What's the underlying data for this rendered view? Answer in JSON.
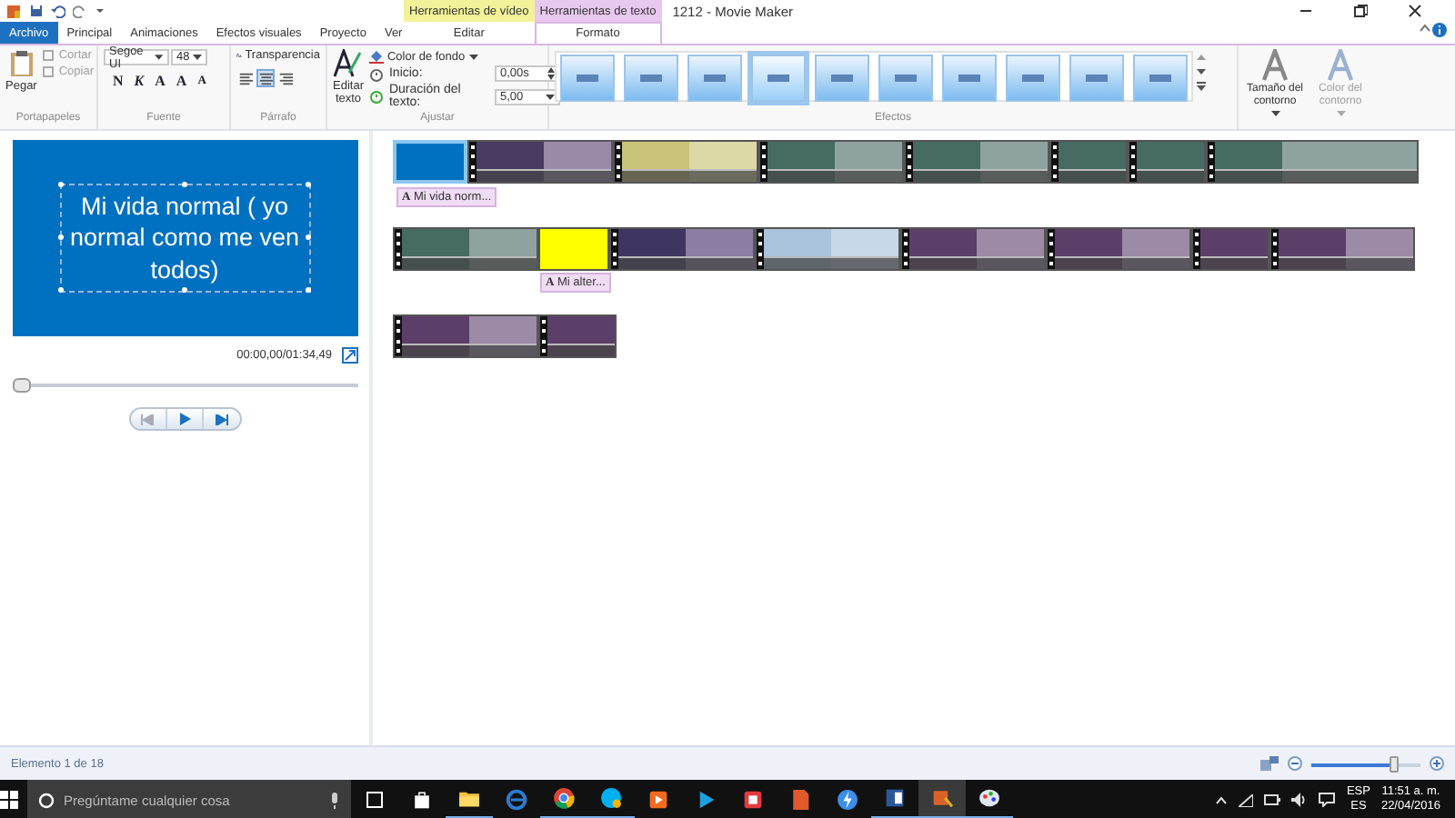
{
  "titlebar": {
    "title": "1212 - Movie Maker",
    "context_groups": [
      {
        "label": "Herramientas de vídeo",
        "color": "#f2f29a",
        "tabs": [
          {
            "label": "Editar",
            "selected": false
          }
        ]
      },
      {
        "label": "Herramientas de texto",
        "color": "#e8c8ef",
        "tabs": [
          {
            "label": "Formato",
            "selected": true
          }
        ]
      }
    ]
  },
  "tabs": [
    {
      "label": "Archivo",
      "kind": "file",
      "selected": false
    },
    {
      "label": "Principal",
      "kind": "tab",
      "selected": false
    },
    {
      "label": "Animaciones",
      "kind": "tab",
      "selected": false
    },
    {
      "label": "Efectos visuales",
      "kind": "tab",
      "selected": false
    },
    {
      "label": "Proyecto",
      "kind": "tab",
      "selected": false
    },
    {
      "label": "Ver",
      "kind": "tab",
      "selected": false
    }
  ],
  "ribbon": {
    "clipboard": {
      "label": "Portapapeles",
      "paste": "Pegar",
      "cut": {
        "label": "Cortar",
        "disabled": true
      },
      "copy": {
        "label": "Copiar",
        "disabled": true
      }
    },
    "font": {
      "label": "Fuente",
      "family": "Segoe UI",
      "size": "48",
      "bold": "N",
      "italic": "K",
      "letter": "A",
      "grow": "A",
      "shrink": "A"
    },
    "paragraph": {
      "label": "Párrafo",
      "transparency": "Transparencia",
      "align": [
        {
          "selected": false
        },
        {
          "selected": true
        },
        {
          "selected": false
        }
      ]
    },
    "adjust": {
      "label": "Ajustar",
      "edit": "Editar texto",
      "background": "Color de fondo",
      "start_label": "Inicio:",
      "start": "0,00s",
      "duration_label": "Duración del texto:",
      "duration": "5,00"
    },
    "effects": {
      "label": "Efectos",
      "items": [
        {
          "selected": false
        },
        {
          "selected": false
        },
        {
          "selected": false
        },
        {
          "selected": true
        },
        {
          "selected": false
        },
        {
          "selected": false
        },
        {
          "selected": false
        },
        {
          "selected": false
        },
        {
          "selected": false
        },
        {
          "selected": false
        }
      ]
    },
    "outline": [
      {
        "label": "Tamaño del contorno",
        "disabled": false
      },
      {
        "label": "Color del contorno",
        "disabled": true
      }
    ]
  },
  "preview": {
    "text": "Mi vida normal ( yo normal como me ven todos)",
    "time": "00:00,00/01:34,49",
    "seek": {
      "level": 0
    }
  },
  "storyboard": {
    "rows": [
      [
        {
          "kind": "title",
          "thumbs": [
            {
              "color": "#0070c0"
            }
          ],
          "selected": true,
          "caption": "**A** Mi vida norm..."
        },
        {
          "kind": "video",
          "thumbs": [
            {
              "color": "#4a3b63"
            },
            {
              "color": "#9a8aa8"
            }
          ],
          "selected": false
        },
        {
          "kind": "video",
          "thumbs": [
            {
              "color": "#c9c47a"
            },
            {
              "color": "#dcd9a6"
            }
          ],
          "selected": false
        },
        {
          "kind": "video",
          "thumbs": [
            {
              "color": "#466b63"
            },
            {
              "color": "#8ea39f"
            }
          ],
          "selected": false
        },
        {
          "kind": "video",
          "thumbs": [
            {
              "color": "#466b63"
            },
            {
              "color": "#8ea39f"
            }
          ],
          "selected": false
        },
        {
          "kind": "video",
          "thumbs": [
            {
              "color": "#466b63"
            }
          ],
          "selected": false
        },
        {
          "kind": "video",
          "thumbs": [
            {
              "color": "#466b63"
            }
          ],
          "selected": false
        },
        {
          "kind": "video",
          "thumbs": [
            {
              "color": "#466b63"
            },
            {
              "color": "#8ea39f"
            },
            {
              "color": "#8ea39f"
            }
          ],
          "selected": false
        }
      ],
      [
        {
          "kind": "video",
          "thumbs": [
            {
              "color": "#466b63"
            },
            {
              "color": "#8ea39f"
            }
          ],
          "selected": false
        },
        {
          "kind": "title",
          "thumbs": [
            {
              "color": "#ffff00"
            }
          ],
          "selected": false,
          "caption": "**A** Mi alter..."
        },
        {
          "kind": "video",
          "thumbs": [
            {
              "color": "#3e3560"
            },
            {
              "color": "#8c7ea3"
            }
          ],
          "selected": false
        },
        {
          "kind": "video",
          "thumbs": [
            {
              "color": "#a9c3dc"
            },
            {
              "color": "#c7d8e8"
            }
          ],
          "selected": false
        },
        {
          "kind": "video",
          "thumbs": [
            {
              "color": "#5b3f68"
            },
            {
              "color": "#9d8aa6"
            }
          ],
          "selected": false
        },
        {
          "kind": "video",
          "thumbs": [
            {
              "color": "#5b3f68"
            },
            {
              "color": "#9d8aa6"
            }
          ],
          "selected": false
        },
        {
          "kind": "video",
          "thumbs": [
            {
              "color": "#5b3f68"
            }
          ],
          "selected": false
        },
        {
          "kind": "video",
          "thumbs": [
            {
              "color": "#5b3f68"
            },
            {
              "color": "#9d8aa6"
            }
          ],
          "selected": false
        }
      ],
      [
        {
          "kind": "video",
          "thumbs": [
            {
              "color": "#5b3f68"
            },
            {
              "color": "#9d8aa6"
            }
          ],
          "selected": false
        },
        {
          "kind": "video",
          "thumbs": [
            {
              "color": "#5b3f68"
            }
          ],
          "selected": false
        }
      ]
    ]
  },
  "status_bar": {
    "text": "Elemento 1 de 18",
    "zoom": {
      "level": 0.75
    }
  },
  "taskbar": {
    "search": {
      "placeholder": "Pregúntame cualquier cosa"
    },
    "apps": [
      {
        "open": false,
        "selected": false
      },
      {
        "open": true,
        "selected": false
      },
      {
        "open": false,
        "selected": false
      },
      {
        "open": true,
        "selected": false
      },
      {
        "open": true,
        "selected": false
      },
      {
        "open": false,
        "selected": false
      },
      {
        "open": false,
        "selected": false
      },
      {
        "open": false,
        "selected": false
      },
      {
        "open": false,
        "selected": false
      },
      {
        "open": false,
        "selected": false
      },
      {
        "open": true,
        "selected": false
      },
      {
        "open": true,
        "selected": true
      },
      {
        "open": true,
        "selected": false
      }
    ],
    "language": "ESP",
    "layout": "ES",
    "time": "11:51 a. m.",
    "date": "22/04/2016"
  }
}
